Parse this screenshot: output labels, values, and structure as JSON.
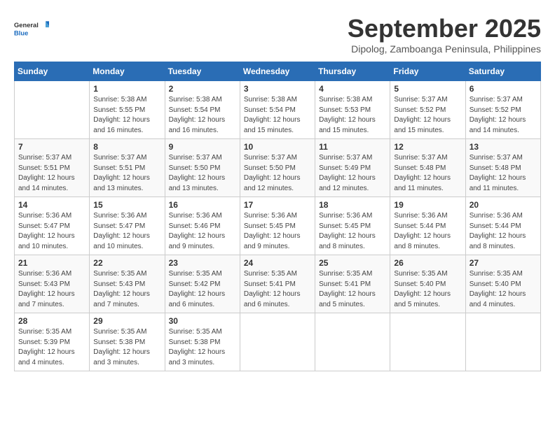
{
  "logo": {
    "general": "General",
    "blue": "Blue"
  },
  "title": "September 2025",
  "subtitle": "Dipolog, Zamboanga Peninsula, Philippines",
  "headers": [
    "Sunday",
    "Monday",
    "Tuesday",
    "Wednesday",
    "Thursday",
    "Friday",
    "Saturday"
  ],
  "weeks": [
    [
      {
        "day": "",
        "info": ""
      },
      {
        "day": "1",
        "info": "Sunrise: 5:38 AM\nSunset: 5:55 PM\nDaylight: 12 hours\nand 16 minutes."
      },
      {
        "day": "2",
        "info": "Sunrise: 5:38 AM\nSunset: 5:54 PM\nDaylight: 12 hours\nand 16 minutes."
      },
      {
        "day": "3",
        "info": "Sunrise: 5:38 AM\nSunset: 5:54 PM\nDaylight: 12 hours\nand 15 minutes."
      },
      {
        "day": "4",
        "info": "Sunrise: 5:38 AM\nSunset: 5:53 PM\nDaylight: 12 hours\nand 15 minutes."
      },
      {
        "day": "5",
        "info": "Sunrise: 5:37 AM\nSunset: 5:52 PM\nDaylight: 12 hours\nand 15 minutes."
      },
      {
        "day": "6",
        "info": "Sunrise: 5:37 AM\nSunset: 5:52 PM\nDaylight: 12 hours\nand 14 minutes."
      }
    ],
    [
      {
        "day": "7",
        "info": "Sunrise: 5:37 AM\nSunset: 5:51 PM\nDaylight: 12 hours\nand 14 minutes."
      },
      {
        "day": "8",
        "info": "Sunrise: 5:37 AM\nSunset: 5:51 PM\nDaylight: 12 hours\nand 13 minutes."
      },
      {
        "day": "9",
        "info": "Sunrise: 5:37 AM\nSunset: 5:50 PM\nDaylight: 12 hours\nand 13 minutes."
      },
      {
        "day": "10",
        "info": "Sunrise: 5:37 AM\nSunset: 5:50 PM\nDaylight: 12 hours\nand 12 minutes."
      },
      {
        "day": "11",
        "info": "Sunrise: 5:37 AM\nSunset: 5:49 PM\nDaylight: 12 hours\nand 12 minutes."
      },
      {
        "day": "12",
        "info": "Sunrise: 5:37 AM\nSunset: 5:48 PM\nDaylight: 12 hours\nand 11 minutes."
      },
      {
        "day": "13",
        "info": "Sunrise: 5:37 AM\nSunset: 5:48 PM\nDaylight: 12 hours\nand 11 minutes."
      }
    ],
    [
      {
        "day": "14",
        "info": "Sunrise: 5:36 AM\nSunset: 5:47 PM\nDaylight: 12 hours\nand 10 minutes."
      },
      {
        "day": "15",
        "info": "Sunrise: 5:36 AM\nSunset: 5:47 PM\nDaylight: 12 hours\nand 10 minutes."
      },
      {
        "day": "16",
        "info": "Sunrise: 5:36 AM\nSunset: 5:46 PM\nDaylight: 12 hours\nand 9 minutes."
      },
      {
        "day": "17",
        "info": "Sunrise: 5:36 AM\nSunset: 5:45 PM\nDaylight: 12 hours\nand 9 minutes."
      },
      {
        "day": "18",
        "info": "Sunrise: 5:36 AM\nSunset: 5:45 PM\nDaylight: 12 hours\nand 8 minutes."
      },
      {
        "day": "19",
        "info": "Sunrise: 5:36 AM\nSunset: 5:44 PM\nDaylight: 12 hours\nand 8 minutes."
      },
      {
        "day": "20",
        "info": "Sunrise: 5:36 AM\nSunset: 5:44 PM\nDaylight: 12 hours\nand 8 minutes."
      }
    ],
    [
      {
        "day": "21",
        "info": "Sunrise: 5:36 AM\nSunset: 5:43 PM\nDaylight: 12 hours\nand 7 minutes."
      },
      {
        "day": "22",
        "info": "Sunrise: 5:35 AM\nSunset: 5:43 PM\nDaylight: 12 hours\nand 7 minutes."
      },
      {
        "day": "23",
        "info": "Sunrise: 5:35 AM\nSunset: 5:42 PM\nDaylight: 12 hours\nand 6 minutes."
      },
      {
        "day": "24",
        "info": "Sunrise: 5:35 AM\nSunset: 5:41 PM\nDaylight: 12 hours\nand 6 minutes."
      },
      {
        "day": "25",
        "info": "Sunrise: 5:35 AM\nSunset: 5:41 PM\nDaylight: 12 hours\nand 5 minutes."
      },
      {
        "day": "26",
        "info": "Sunrise: 5:35 AM\nSunset: 5:40 PM\nDaylight: 12 hours\nand 5 minutes."
      },
      {
        "day": "27",
        "info": "Sunrise: 5:35 AM\nSunset: 5:40 PM\nDaylight: 12 hours\nand 4 minutes."
      }
    ],
    [
      {
        "day": "28",
        "info": "Sunrise: 5:35 AM\nSunset: 5:39 PM\nDaylight: 12 hours\nand 4 minutes."
      },
      {
        "day": "29",
        "info": "Sunrise: 5:35 AM\nSunset: 5:38 PM\nDaylight: 12 hours\nand 3 minutes."
      },
      {
        "day": "30",
        "info": "Sunrise: 5:35 AM\nSunset: 5:38 PM\nDaylight: 12 hours\nand 3 minutes."
      },
      {
        "day": "",
        "info": ""
      },
      {
        "day": "",
        "info": ""
      },
      {
        "day": "",
        "info": ""
      },
      {
        "day": "",
        "info": ""
      }
    ]
  ]
}
